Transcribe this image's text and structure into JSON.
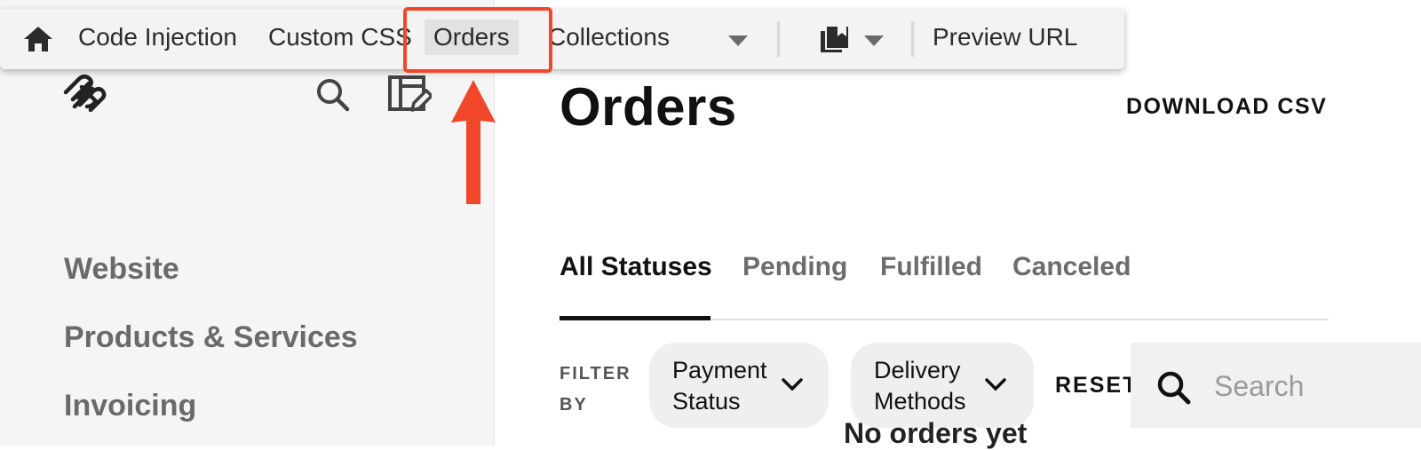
{
  "toolbar": {
    "items": [
      "Code Injection",
      "Custom CSS",
      "Orders",
      "Collections"
    ],
    "preview_label": "Preview URL",
    "icons": {
      "home": "home-icon",
      "bookmark": "bookmark-icon",
      "caret": "caret-down-icon"
    }
  },
  "sidebar": {
    "items": [
      "Website",
      "Products & Services",
      "Invoicing"
    ],
    "icons": {
      "logo": "squarespace-logo",
      "search": "search-icon",
      "edit": "edit-layout-icon"
    }
  },
  "main": {
    "title": "Orders",
    "download_label": "DOWNLOAD CSV",
    "tabs": [
      "All Statuses",
      "Pending",
      "Fulfilled",
      "Canceled"
    ],
    "active_tab": "All Statuses",
    "filter_label_line1": "FILTER",
    "filter_label_line2": "BY",
    "filters": [
      {
        "line1": "Payment",
        "line2": "Status"
      },
      {
        "line1": "Delivery",
        "line2": "Methods"
      }
    ],
    "reset_label": "RESET",
    "search": {
      "placeholder": "Search",
      "value": ""
    },
    "empty_message": "No orders yet"
  },
  "colors": {
    "annotation": "#f0472a",
    "sidebar_bg": "#f5f5f5",
    "toolbar_bg": "#f3f3f3",
    "text_primary": "#111111",
    "text_muted": "#6a6a6a"
  }
}
